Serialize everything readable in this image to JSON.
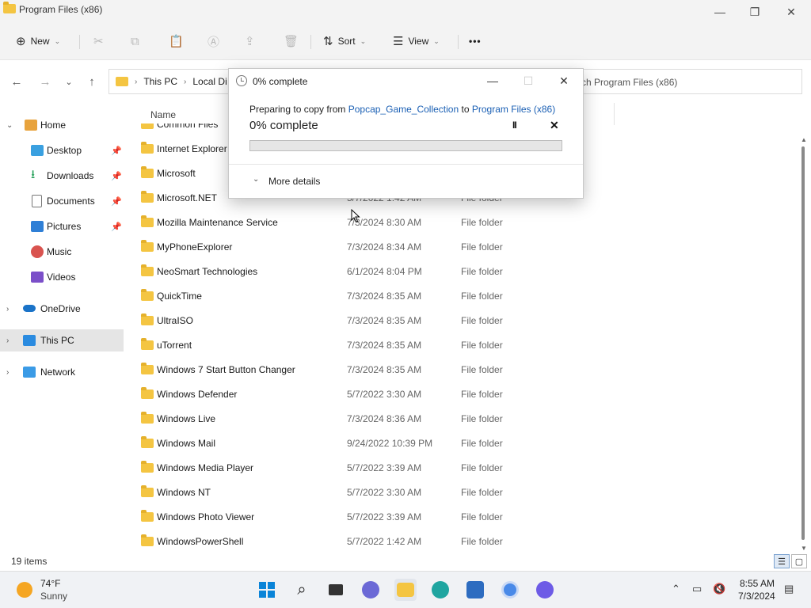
{
  "window": {
    "title": "Program Files (x86)",
    "controls": {
      "minimize": "—",
      "maximize": "❐",
      "close": "✕"
    }
  },
  "commandbar": {
    "new_label": "New",
    "sort_label": "Sort",
    "view_label": "View",
    "more_label": "•••"
  },
  "address": {
    "crumbs": [
      "This PC",
      "Local Di"
    ],
    "search_text": "ch Program Files (x86)"
  },
  "nav": {
    "items": [
      {
        "label": "Home"
      },
      {
        "label": "Desktop"
      },
      {
        "label": "Downloads"
      },
      {
        "label": "Documents"
      },
      {
        "label": "Pictures"
      },
      {
        "label": "Music"
      },
      {
        "label": "Videos"
      },
      {
        "label": "OneDrive"
      },
      {
        "label": "This PC"
      },
      {
        "label": "Network"
      }
    ]
  },
  "columns": {
    "name": "Name"
  },
  "files": [
    {
      "name": "Common Files",
      "date": "",
      "type": ""
    },
    {
      "name": "Internet Explorer",
      "date": "",
      "type": ""
    },
    {
      "name": "Microsoft",
      "date": "",
      "type": ""
    },
    {
      "name": "Microsoft.NET",
      "date": "5/7/2022 1:42 AM",
      "type": "File folder"
    },
    {
      "name": "Mozilla Maintenance Service",
      "date": "7/3/2024 8:30 AM",
      "type": "File folder"
    },
    {
      "name": "MyPhoneExplorer",
      "date": "7/3/2024 8:34 AM",
      "type": "File folder"
    },
    {
      "name": "NeoSmart Technologies",
      "date": "6/1/2024 8:04 PM",
      "type": "File folder"
    },
    {
      "name": "QuickTime",
      "date": "7/3/2024 8:35 AM",
      "type": "File folder"
    },
    {
      "name": "UltraISO",
      "date": "7/3/2024 8:35 AM",
      "type": "File folder"
    },
    {
      "name": "uTorrent",
      "date": "7/3/2024 8:35 AM",
      "type": "File folder"
    },
    {
      "name": "Windows 7 Start Button Changer",
      "date": "7/3/2024 8:35 AM",
      "type": "File folder"
    },
    {
      "name": "Windows Defender",
      "date": "5/7/2022 3:30 AM",
      "type": "File folder"
    },
    {
      "name": "Windows Live",
      "date": "7/3/2024 8:36 AM",
      "type": "File folder"
    },
    {
      "name": "Windows Mail",
      "date": "9/24/2022 10:39 PM",
      "type": "File folder"
    },
    {
      "name": "Windows Media Player",
      "date": "5/7/2022 3:39 AM",
      "type": "File folder"
    },
    {
      "name": "Windows NT",
      "date": "5/7/2022 3:30 AM",
      "type": "File folder"
    },
    {
      "name": "Windows Photo Viewer",
      "date": "5/7/2022 3:39 AM",
      "type": "File folder"
    },
    {
      "name": "WindowsPowerShell",
      "date": "5/7/2022 1:42 AM",
      "type": "File folder"
    }
  ],
  "status": {
    "count": "19 items"
  },
  "dialog": {
    "title": "0% complete",
    "preparing_prefix": "Preparing to copy from ",
    "source": "Popcap_Game_Collection",
    "to_word": " to ",
    "destination": "Program Files (x86)",
    "percent_text": "0% complete",
    "progress": 0,
    "more_details": "More details",
    "pause_glyph": "II",
    "cancel_glyph": "✕"
  },
  "taskbar": {
    "temp": "74°F",
    "condition": "Sunny",
    "time": "8:55 AM",
    "date": "7/3/2024"
  },
  "colors": {
    "folder": "#f4c542",
    "link": "#1a5fb4",
    "accent": "#0067c0",
    "progress_fill": "#06b025"
  }
}
